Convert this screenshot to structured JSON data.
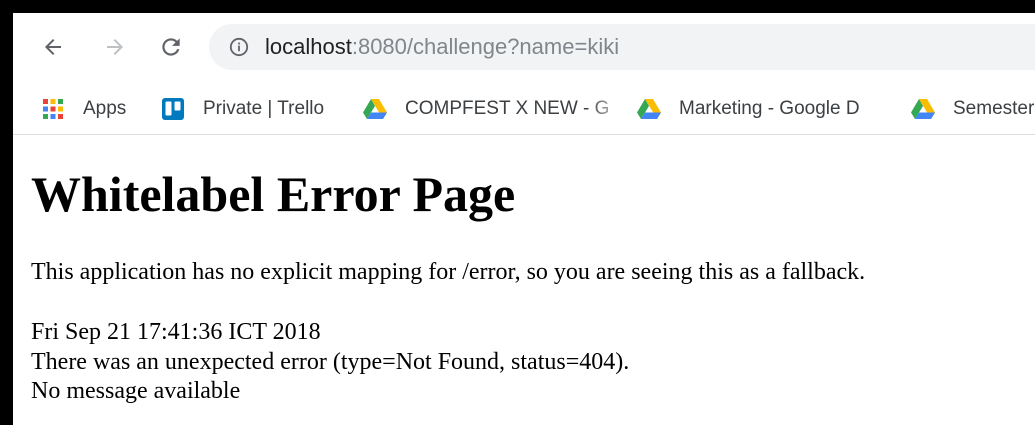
{
  "browser": {
    "url_host": "localhost",
    "url_rest": ":8080/challenge?name=kiki"
  },
  "bookmarks": [
    {
      "label": "Apps",
      "icon": "apps-grid-icon"
    },
    {
      "label": "Private | Trello",
      "icon": "trello-icon"
    },
    {
      "label": "COMPFEST X NEW - G",
      "icon": "google-drive-icon"
    },
    {
      "label": "Marketing - Google D",
      "icon": "google-drive-icon"
    },
    {
      "label": "Semester",
      "icon": "google-drive-icon"
    }
  ],
  "page": {
    "title": "Whitelabel Error Page",
    "message": "This application has no explicit mapping for /error, so you are seeing this as a fallback.",
    "timestamp": "Fri Sep 21 17:41:36 ICT 2018",
    "error_detail": "There was an unexpected error (type=Not Found, status=404).",
    "error_message": "No message available"
  },
  "colors": {
    "omnibox_bg": "#f1f3f4",
    "trello_blue": "#0079bf"
  }
}
